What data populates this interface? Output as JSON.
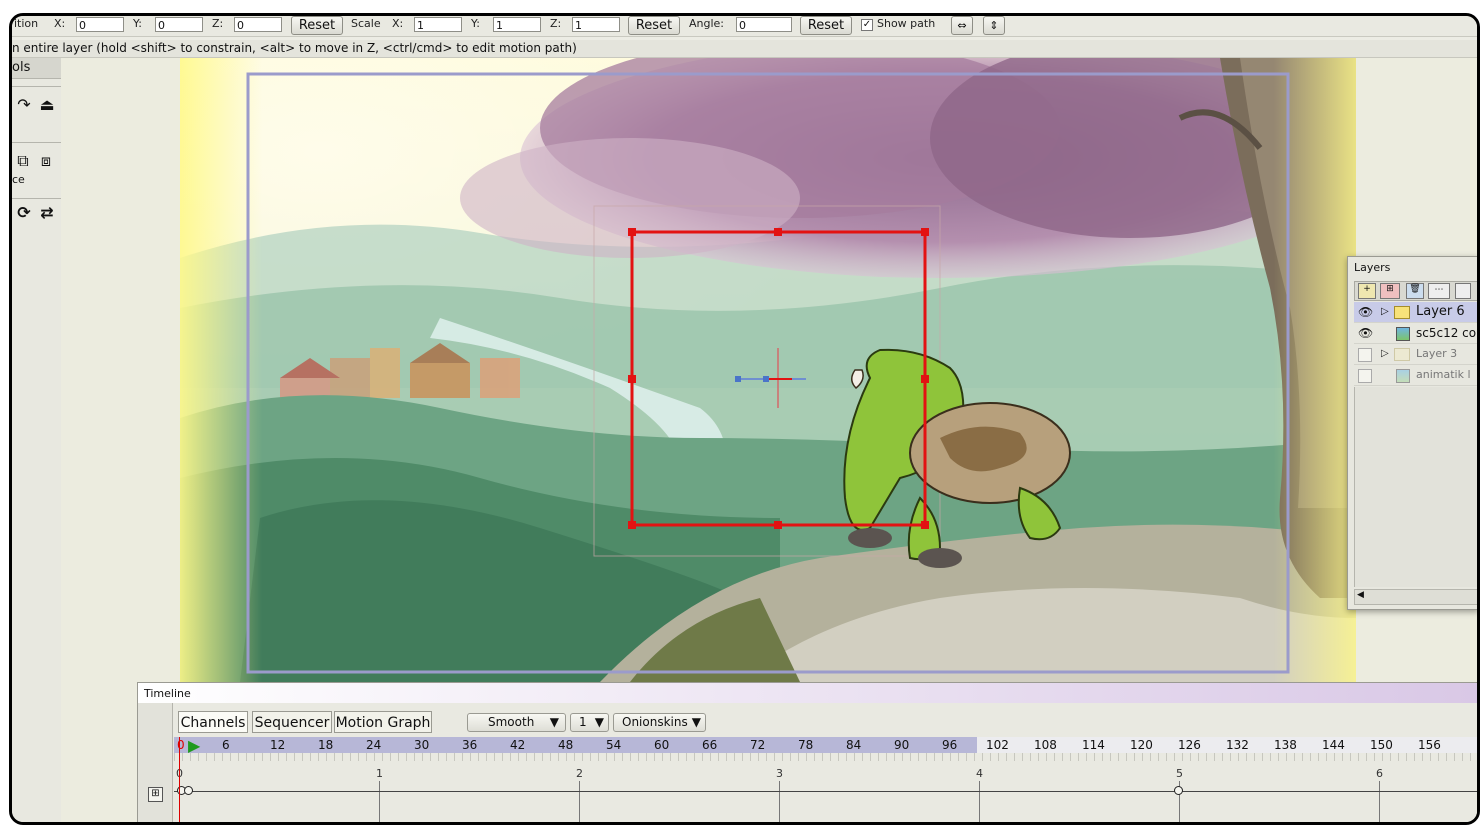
{
  "toolbar": {
    "position_label": "ition",
    "x_label": "X:",
    "x_value": "0",
    "y_label": "Y:",
    "y_value": "0",
    "z_label": "Z:",
    "z_value": "0",
    "reset1": "Reset",
    "scale_label": "Scale",
    "sx_label": "X:",
    "sx_value": "1",
    "sy_label": "Y:",
    "sy_value": "1",
    "sz_label": "Z:",
    "sz_value": "1",
    "reset2": "Reset",
    "angle_label": "Angle:",
    "angle_value": "0",
    "reset3": "Reset",
    "show_path_label": "Show path"
  },
  "hint": "n entire layer (hold <shift> to constrain, <alt> to move in Z, <ctrl/cmd> to edit motion path)",
  "tools": {
    "title": "ols",
    "section_label": "ce"
  },
  "layers": {
    "title": "Layers",
    "items": [
      {
        "name": "Layer 6",
        "selected": true
      },
      {
        "name": "sc5c12 co"
      },
      {
        "name": "Layer 3"
      },
      {
        "name": "animatik l"
      }
    ]
  },
  "timeline": {
    "title": "Timeline",
    "tabs": [
      "Channels",
      "Sequencer",
      "Motion Graph"
    ],
    "interp": "Smooth",
    "step": "1",
    "onion": "Onionskins",
    "current_frame": "0",
    "frame_ticks": [
      "6",
      "12",
      "18",
      "24",
      "30",
      "36",
      "42",
      "48",
      "54",
      "60",
      "66",
      "72",
      "78",
      "84",
      "90",
      "96",
      "102",
      "108",
      "114",
      "120",
      "126",
      "132",
      "138",
      "144",
      "150",
      "156"
    ],
    "second_ticks": [
      "0",
      "1",
      "2",
      "3",
      "4",
      "5",
      "6"
    ]
  },
  "colors": {
    "selection": "#e31212",
    "camera_frame": "#9b9bcb",
    "ruler_active": "#b7b7d7",
    "play": "#1f9a1f"
  }
}
